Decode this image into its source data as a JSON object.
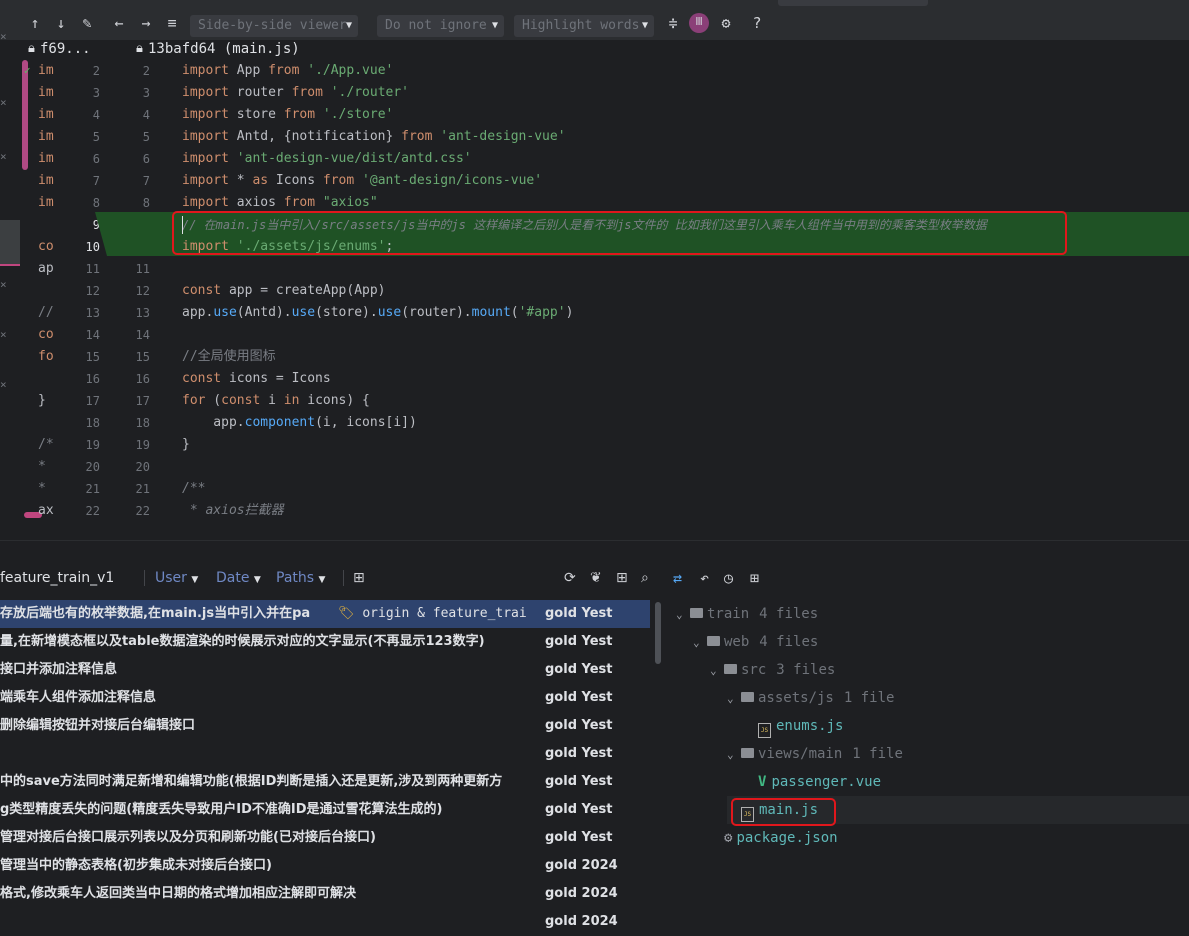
{
  "toolbar": {
    "viewer_mode": "Side-by-side viewer",
    "ignore_mode": "Do not ignore",
    "highlight_mode": "Highlight words",
    "help": "?"
  },
  "file_header": {
    "left_rev": "f69...",
    "right_rev": "13bafd64 (main.js)"
  },
  "left_pane_lines": [
    "im",
    "im",
    "im",
    "im",
    "im",
    "im",
    "im",
    "",
    "co",
    "ap",
    "",
    "//",
    "co",
    "fo",
    "",
    "}",
    "",
    "/*",
    "*",
    "*",
    "ax"
  ],
  "line_numbers_left": [
    "2",
    "3",
    "4",
    "5",
    "6",
    "7",
    "8",
    "9",
    "10",
    "11",
    "12",
    "13",
    "14",
    "15",
    "16",
    "17",
    "18",
    "19",
    "20",
    "21",
    "22"
  ],
  "line_numbers_right": [
    "2",
    "3",
    "4",
    "5",
    "6",
    "7",
    "8",
    "9",
    "10",
    "11",
    "12",
    "13",
    "14",
    "15",
    "16",
    "17",
    "18",
    "19",
    "20",
    "21",
    "22"
  ],
  "code": {
    "l2": {
      "kw": "import",
      "id": " App ",
      "kw2": "from",
      "str": " './App.vue'"
    },
    "l3": {
      "kw": "import",
      "id": " router ",
      "kw2": "from",
      "str": " './router'"
    },
    "l4": {
      "kw": "import",
      "id": " store ",
      "kw2": "from",
      "str": " './store'"
    },
    "l5": {
      "kw": "import",
      "id": " Antd, {notification} ",
      "kw2": "from",
      "str": " 'ant-design-vue'"
    },
    "l6": {
      "kw": "import",
      "str": " 'ant-design-vue/dist/antd.css'"
    },
    "l7": {
      "kw": "import",
      "id": " * ",
      "kw2": "as",
      "id2": " Icons ",
      "kw3": "from",
      "str": " '@ant-design/icons-vue'"
    },
    "l8": {
      "kw": "import",
      "id": " axios ",
      "kw2": "from",
      "str": " \"axios\""
    },
    "l9": {
      "cm": "// 在main.js当中引入/src/assets/js当中的js 这样编译之后别人是看不到js文件的 比如我们这里引入乘车人组件当中用到的乘客类型枚举数据"
    },
    "l10": {
      "kw": "import",
      "str": " './assets/js/enums'",
      "id": ";"
    },
    "l12": {
      "kw": "const",
      "id": " app = createApp(App)"
    },
    "l13": {
      "a": "app.",
      "b": "use",
      "c": "(Antd).",
      "d": "use",
      "e": "(store).",
      "f": "use",
      "g": "(router).",
      "h": "mount",
      "i": "(",
      "j": "'#app'",
      "k": ")"
    },
    "l15": {
      "cm": "//全局使用图标"
    },
    "l16": {
      "kw": "const",
      "id": " icons = Icons"
    },
    "l17": {
      "kw": "for",
      "id": " (",
      "kw2": "const",
      "id2": " i ",
      "kw3": "in",
      "id3": " icons) {"
    },
    "l18": {
      "a": "    app.",
      "b": "component",
      "c": "(i, icons[i])"
    },
    "l19": {
      "id": "}"
    },
    "l21": {
      "cm": "/**"
    },
    "l22": {
      "cm": " * axios拦截器"
    }
  },
  "log_toolbar": {
    "branch": "feature_train_v1",
    "user": "User",
    "date": "Date",
    "paths": "Paths"
  },
  "commits": [
    {
      "msg": "存放后端也有的枚举数据,在main.js当中引入并在pa",
      "tag": "origin & feature_trai",
      "author": "gold Yest"
    },
    {
      "msg": "量,在新增模态框以及table数据渲染的时候展示对应的文字显示(不再显示123数字)",
      "tag": "",
      "author": "gold Yest"
    },
    {
      "msg": "接口并添加注释信息",
      "tag": "",
      "author": "gold Yest"
    },
    {
      "msg": "端乘车人组件添加注释信息",
      "tag": "",
      "author": "gold Yest"
    },
    {
      "msg": "删除编辑按钮并对接后台编辑接口",
      "tag": "",
      "author": "gold Yest"
    },
    {
      "msg": "",
      "tag": "",
      "author": "gold Yest"
    },
    {
      "msg": "中的save方法同时满足新增和编辑功能(根据ID判断是插入还是更新,涉及到两种更新方",
      "tag": "",
      "author": "gold Yest"
    },
    {
      "msg": "g类型精度丢失的问题(精度丢失导致用户ID不准确ID是通过雪花算法生成的)",
      "tag": "",
      "author": "gold Yest"
    },
    {
      "msg": "管理对接后台接口展示列表以及分页和刷新功能(已对接后台接口)",
      "tag": "",
      "author": "gold Yest"
    },
    {
      "msg": "管理当中的静态表格(初步集成未对接后台接口)",
      "tag": "",
      "author": "gold 2024"
    },
    {
      "msg": "格式,修改乘车人返回类当中日期的格式增加相应注解即可解决",
      "tag": "",
      "author": "gold 2024"
    },
    {
      "msg": "",
      "tag": "",
      "author": "gold 2024"
    }
  ],
  "tree": [
    {
      "name": "train",
      "count": "4 files",
      "kind": "folder",
      "depth": 0
    },
    {
      "name": "web",
      "count": "4 files",
      "kind": "folder",
      "depth": 1
    },
    {
      "name": "src",
      "count": "3 files",
      "kind": "folder",
      "depth": 2
    },
    {
      "name": "assets/js",
      "count": "1 file",
      "kind": "folder",
      "depth": 3
    },
    {
      "name": "enums.js",
      "count": "",
      "kind": "js",
      "depth": 4
    },
    {
      "name": "views/main",
      "count": "1 file",
      "kind": "folder",
      "depth": 3
    },
    {
      "name": "passenger.vue",
      "count": "",
      "kind": "vue",
      "depth": 4
    },
    {
      "name": "main.js",
      "count": "",
      "kind": "js",
      "depth": 3
    },
    {
      "name": "package.json",
      "count": "",
      "kind": "json",
      "depth": 2
    }
  ],
  "colors": {
    "added_line_bg": "#1f5225",
    "highlight_box": "#e0171c",
    "keyword": "#cf8e6d",
    "string": "#6aab73",
    "comment": "#7a7e85"
  }
}
